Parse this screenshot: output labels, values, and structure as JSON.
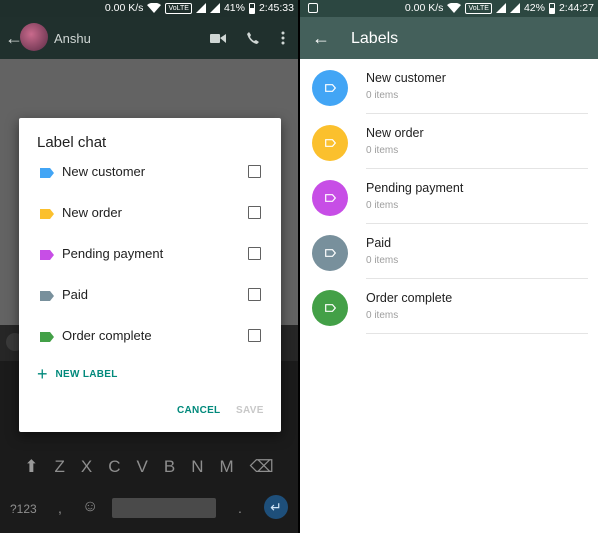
{
  "left": {
    "status": {
      "speed": "0.00 K/s",
      "network": "VoLTE",
      "battery": "41%",
      "time": "2:45:33"
    },
    "chat": {
      "contact_name": "Anshu"
    },
    "dialog": {
      "title": "Label chat",
      "labels": [
        {
          "name": "New customer",
          "color": "#42a5f5"
        },
        {
          "name": "New order",
          "color": "#fbc02d"
        },
        {
          "name": "Pending payment",
          "color": "#c74ee6"
        },
        {
          "name": "Paid",
          "color": "#78909c"
        },
        {
          "name": "Order complete",
          "color": "#43a047"
        }
      ],
      "new_label": "NEW LABEL",
      "cancel": "CANCEL",
      "save": "SAVE"
    },
    "keyboard": {
      "row": [
        "Z",
        "X",
        "C",
        "V",
        "B",
        "N",
        "M"
      ],
      "symbols_key": "?123",
      "comma_key": ","
    }
  },
  "right": {
    "status": {
      "speed": "0.00 K/s",
      "network": "VoLTE",
      "battery": "42%",
      "time": "2:44:27"
    },
    "title": "Labels",
    "labels": [
      {
        "name": "New customer",
        "count": "0 items",
        "color": "#42a5f5"
      },
      {
        "name": "New order",
        "count": "0 items",
        "color": "#fbc02d"
      },
      {
        "name": "Pending payment",
        "count": "0 items",
        "color": "#c74ee6"
      },
      {
        "name": "Paid",
        "count": "0 items",
        "color": "#78909c"
      },
      {
        "name": "Order complete",
        "count": "0 items",
        "color": "#43a047"
      }
    ]
  }
}
